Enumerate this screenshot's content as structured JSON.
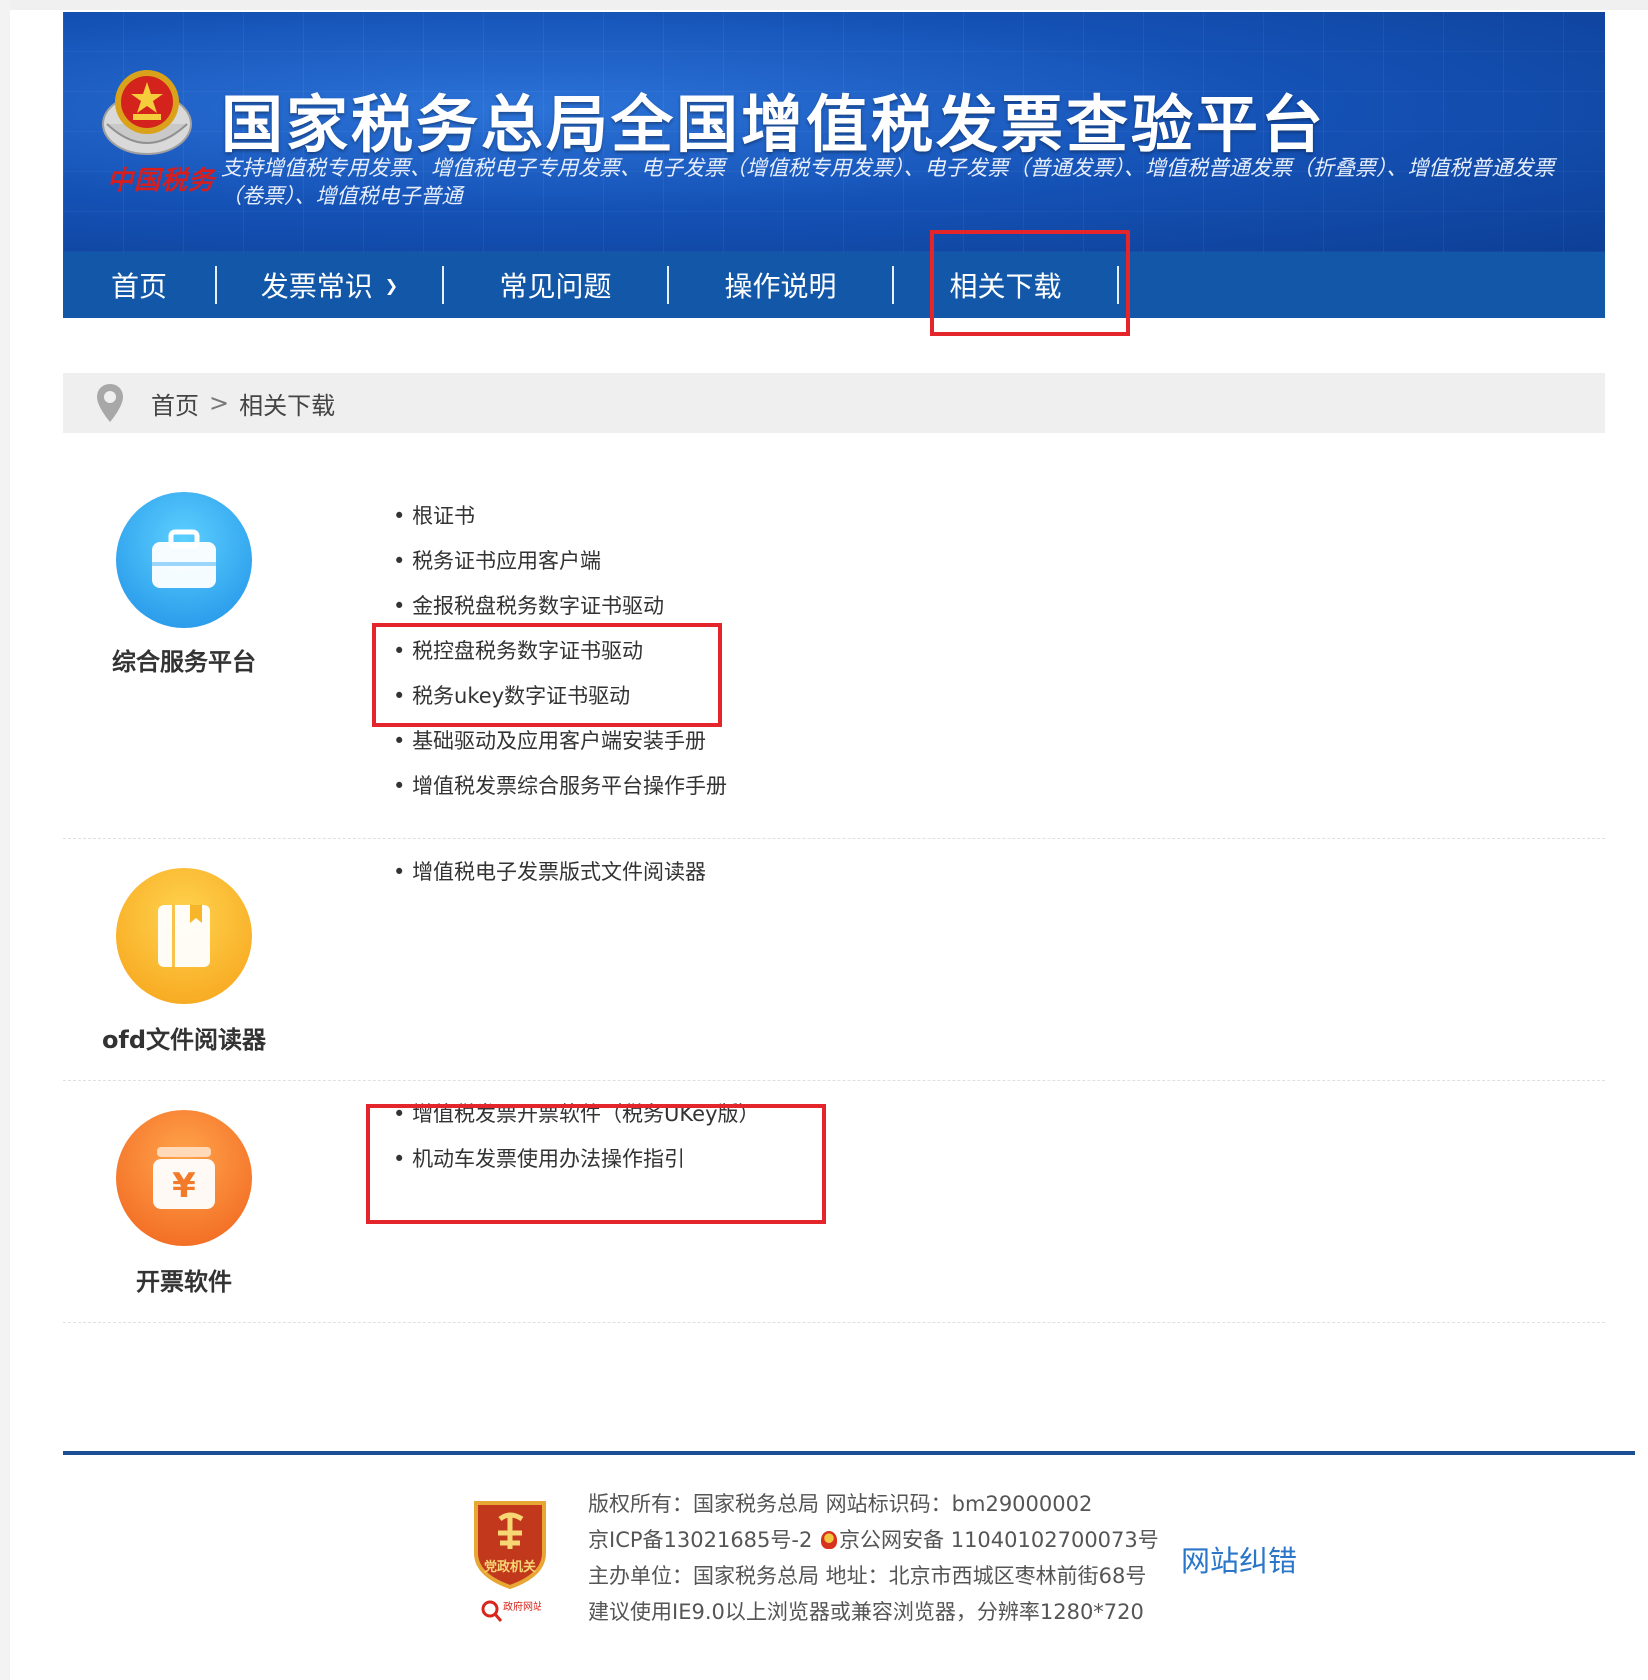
{
  "header": {
    "title": "国家税务总局全国增值税发票查验平台",
    "subtitle": "支持增值税专用发票、增值税电子专用发票、电子发票（增值税专用发票）、电子发票（普通发票）、增值税普通发票（折叠票）、增值税普通发票（卷票）、增值税电子普通",
    "logo_script": "中国税务"
  },
  "nav": {
    "items": [
      {
        "label": "首页"
      },
      {
        "label": "发票常识"
      },
      {
        "label": "常见问题"
      },
      {
        "label": "操作说明"
      },
      {
        "label": "相关下载"
      }
    ],
    "highlighted": "相关下载"
  },
  "breadcrumb": {
    "home": "首页",
    "separator": ">",
    "current": "相关下载"
  },
  "sections": [
    {
      "title": "综合服务平台",
      "icon": "briefcase-icon",
      "color": "#2fa8ee",
      "links": [
        "根证书",
        "税务证书应用客户端",
        "金报税盘税务数字证书驱动",
        "税控盘税务数字证书驱动",
        "税务ukey数字证书驱动",
        "基础驱动及应用客户端安装手册",
        "增值税发票综合服务平台操作手册"
      ]
    },
    {
      "title": "ofd文件阅读器",
      "icon": "book-icon",
      "color": "#f9b11f",
      "links": [
        "增值税电子发票版式文件阅读器"
      ]
    },
    {
      "title": "开票软件",
      "icon": "yuan-box-icon",
      "color": "#f57a22",
      "links": [
        "增值税发票开票软件（税务UKey版）",
        "机动车发票使用办法操作指引"
      ]
    }
  ],
  "footer": {
    "copyright": "版权所有：国家税务总局 网站标识码：bm29000002",
    "icp_prefix": "京ICP备13021685号-2 ",
    "icp_police": "京公网安备 11040102700073号",
    "host": "主办单位：国家税务总局 地址：北京市西城区枣林前街68号",
    "browser": "建议使用IE9.0以上浏览器或兼容浏览器，分辨率1280*720",
    "report_link": "网站纠错",
    "logo_text": "党政机关",
    "badge_text": "政府网站找错"
  },
  "colors": {
    "banner": "#1552b6",
    "nav": "#1257a8",
    "highlight_box": "#e4262c",
    "footer_line": "#1a4f96"
  }
}
